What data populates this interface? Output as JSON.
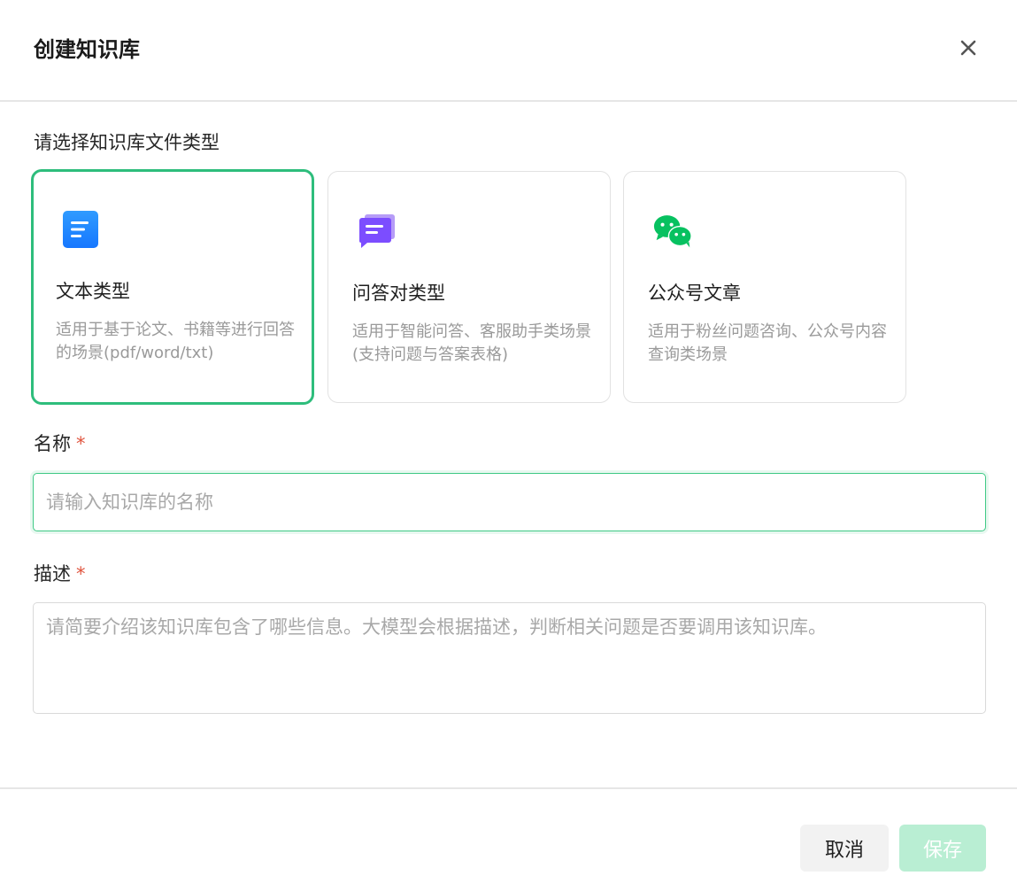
{
  "dialog": {
    "title": "创建知识库"
  },
  "type_section": {
    "label": "请选择知识库文件类型",
    "cards": [
      {
        "title": "文本类型",
        "desc": "适用于基于论文、书籍等进行回答的场景(pdf/word/txt)",
        "icon": "document-icon",
        "selected": true
      },
      {
        "title": "问答对类型",
        "desc": "适用于智能问答、客服助手类场景(支持问题与答案表格)",
        "icon": "qa-chat-icon",
        "selected": false
      },
      {
        "title": "公众号文章",
        "desc": "适用于粉丝问题咨询、公众号内容查询类场景",
        "icon": "wechat-icon",
        "selected": false
      }
    ]
  },
  "name_field": {
    "label": "名称",
    "required_mark": "*",
    "placeholder": "请输入知识库的名称",
    "value": ""
  },
  "desc_field": {
    "label": "描述",
    "required_mark": "*",
    "placeholder": "请简要介绍该知识库包含了哪些信息。大模型会根据描述，判断相关问题是否要调用该知识库。",
    "value": ""
  },
  "footer": {
    "cancel_label": "取消",
    "save_label": "保存"
  },
  "colors": {
    "accent": "#2ebd7c",
    "save_disabled": "#b9eed3",
    "required": "#e0533d"
  }
}
